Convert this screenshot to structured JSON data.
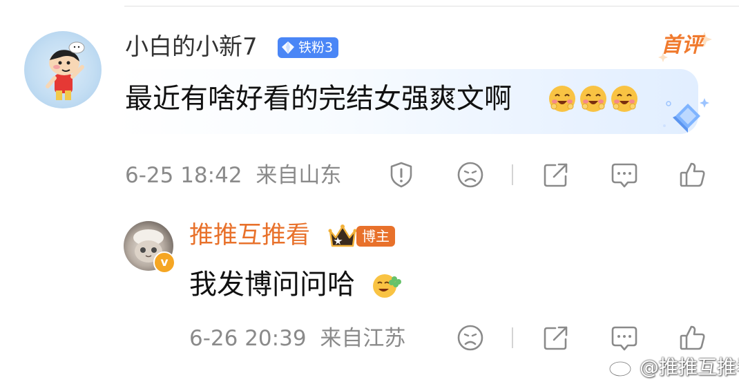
{
  "comment": {
    "username": "小白的小新7",
    "fan_badge": "铁粉3",
    "top_badge": "首评",
    "text": "最近有啥好看的完结女强爽文啊",
    "emoji_icons": [
      "laughing-blush-emoji-icon",
      "laughing-blush-emoji-icon",
      "laughing-blush-emoji-icon"
    ],
    "timestamp": "6-25 18:42",
    "location": "来自山东"
  },
  "reply": {
    "username": "推推互推看",
    "host_badge": "博主",
    "verified_mark": "v",
    "text": "我发博问问哈",
    "emoji_icon": "clover-smile-emoji-icon",
    "timestamp": "6-26 20:39",
    "location": "来自江苏"
  },
  "watermark": "@推推互推看",
  "colors": {
    "fan_badge": "#4a86f6",
    "reply_name": "#e8712b",
    "host_badge": "#e8712b",
    "meta_text": "#8a8a8a",
    "icon": "#8a8a8a"
  }
}
